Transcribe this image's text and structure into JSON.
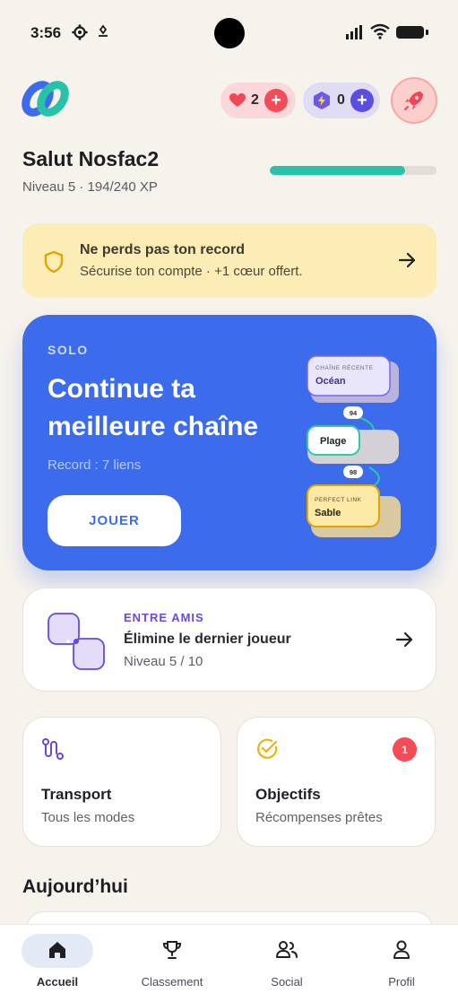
{
  "status_bar": {
    "time": "3:56"
  },
  "header": {
    "hearts_count": "2",
    "energy_count": "0"
  },
  "profile": {
    "greeting": "Salut Nosfac2",
    "level_text": "Niveau 5 · 194/240 XP",
    "xp_progress": 0.81
  },
  "banner": {
    "title": "Ne perds pas ton record",
    "subtitle": "Sécurise ton compte · +1 cœur offert."
  },
  "solo": {
    "tag": "SOLO",
    "title": "Continue ta meilleure chaîne",
    "record": "Record : 7 liens",
    "play_label": "JOUER",
    "chain": {
      "recent_label": "CHAÎNE RÉCENTE",
      "recent_word": "Océan",
      "link1": "94",
      "middle_word": "Plage",
      "link2": "98",
      "perfect_label": "PERFECT LINK",
      "last_word": "Sable"
    }
  },
  "friends": {
    "tag": "ENTRE AMIS",
    "title": "Élimine le dernier joueur",
    "subtitle": "Niveau 5 / 10"
  },
  "cards": {
    "transport": {
      "title": "Transport",
      "subtitle": "Tous les modes"
    },
    "objectives": {
      "title": "Objectifs",
      "subtitle": "Récompenses prêtes",
      "badge": "1"
    }
  },
  "today": {
    "title": "Aujourd’hui"
  },
  "nav": [
    {
      "label": "Accueil",
      "icon": "home-icon",
      "active": true
    },
    {
      "label": "Classement",
      "icon": "trophy-icon",
      "active": false
    },
    {
      "label": "Social",
      "icon": "users-icon",
      "active": false
    },
    {
      "label": "Profil",
      "icon": "user-icon",
      "active": false
    }
  ],
  "colors": {
    "background": "#f6f2ec",
    "primary": "#3c6cec",
    "accent_teal": "#27c2a8",
    "accent_purple": "#6a48e0",
    "alert_red": "#f44c57",
    "banner_yellow": "#fcecb5"
  }
}
